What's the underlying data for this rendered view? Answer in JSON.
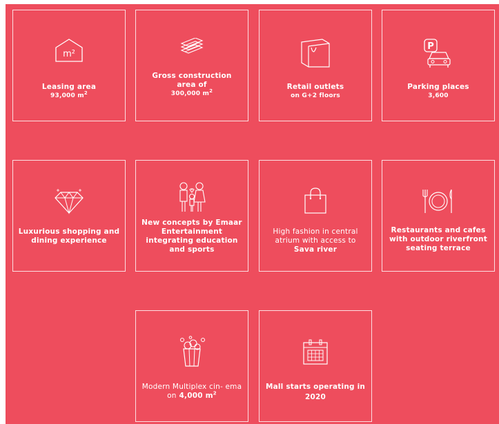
{
  "colors": {
    "background": "#ee4d5d",
    "line": "#ffffff"
  },
  "cards": [
    {
      "icon": "area-icon",
      "label": "Leasing area",
      "value": "93,000 m",
      "unit_sup": "2",
      "icon_text": "m²"
    },
    {
      "icon": "layers-icon",
      "label_line1": "Gross construction",
      "label_line2": "area of",
      "value": "300,000 m",
      "unit_sup": "2"
    },
    {
      "icon": "shopping-bag-icon",
      "label": "Retail outlets",
      "value": "on G+2 floors"
    },
    {
      "icon": "parking-icon",
      "label": "Parking places",
      "value": "3,600",
      "icon_text": "P"
    },
    {
      "icon": "diamond-icon",
      "text": "Luxurious shopping and dining experience"
    },
    {
      "icon": "family-icon",
      "text": "New concepts by Emaar Entertainment integrating education and sports"
    },
    {
      "icon": "bag-icon",
      "text": "High fashion in central atrium with access to",
      "bold": "Sava river"
    },
    {
      "icon": "dining-icon",
      "text": "Restaurants and cafes with outdoor riverfront seating terrace"
    },
    {
      "icon": "popcorn-icon",
      "text": "Modern Multiplex cin- ema on",
      "bold": "4,000 m",
      "unit_sup": "2"
    },
    {
      "icon": "calendar-icon",
      "text": "Mall starts operating in",
      "value": "2020"
    }
  ]
}
